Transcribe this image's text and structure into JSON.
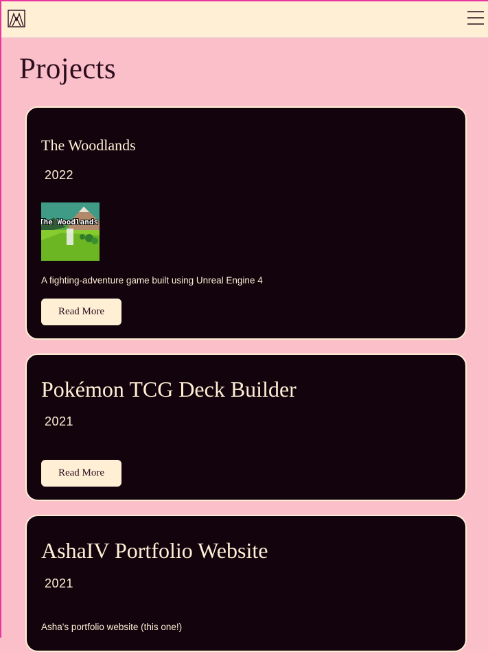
{
  "nav": {
    "logo_icon": "triangle-logo-icon",
    "menu_icon": "hamburger-menu-icon"
  },
  "page": {
    "title": "Projects"
  },
  "projects": [
    {
      "title": "The Woodlands",
      "year": "2022",
      "thumbnail_text": "The Woodlands",
      "description": "A fighting-adventure game built using Unreal Engine 4",
      "button_label": "Read More"
    },
    {
      "title": "Pokémon TCG Deck Builder",
      "year": "2021",
      "button_label": "Read More"
    },
    {
      "title": "AshaIV Portfolio Website",
      "year": "2021",
      "description": "Asha's portfolio website (this one!)"
    }
  ],
  "colors": {
    "background": "#fbbfca",
    "navbar": "#ffefd5",
    "card": "#12030d",
    "text_dark": "#2b0d1d",
    "text_light": "#ffefd5",
    "accent_border": "#e8359f"
  }
}
